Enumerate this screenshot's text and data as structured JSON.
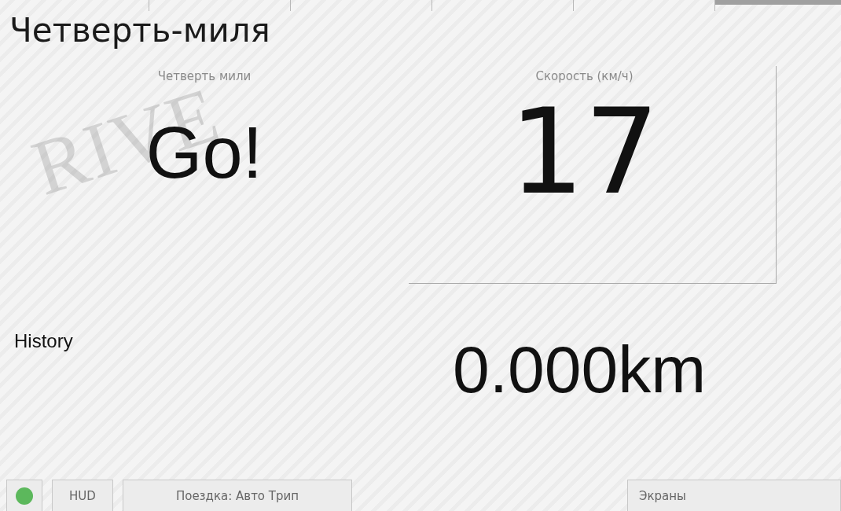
{
  "tabs": [
    {
      "selected": false
    },
    {
      "selected": false
    },
    {
      "selected": false
    },
    {
      "selected": false
    },
    {
      "selected": false
    },
    {
      "selected": true
    }
  ],
  "title": "Четверть-миля",
  "background_logo": "RIVE",
  "quarter_mile": {
    "label": "Четверть мили",
    "value": "Go!"
  },
  "speed": {
    "label": "Скорость (км/ч)",
    "value": "17"
  },
  "history": {
    "label": "History"
  },
  "distance": "0.000km",
  "status_bar": {
    "connected": true,
    "hud": "HUD",
    "trip": "Поездка: Авто Трип",
    "screens": "Экраны"
  }
}
